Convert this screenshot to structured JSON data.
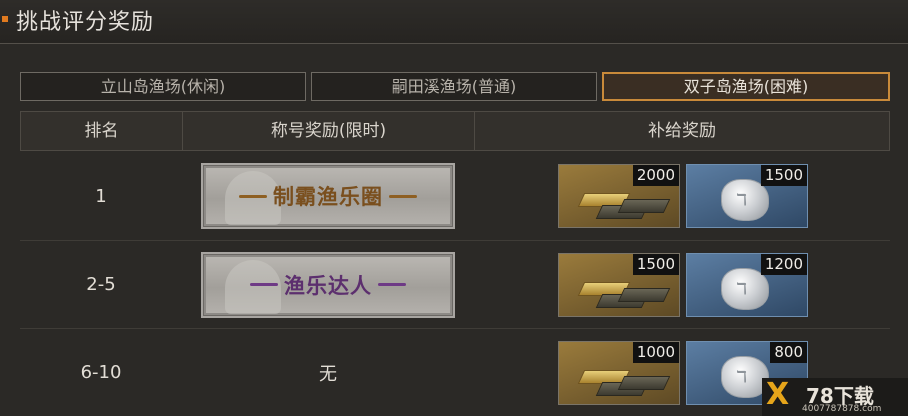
{
  "header": {
    "title": "挑战评分奖励"
  },
  "tabs": [
    {
      "label": "立山岛渔场(休闲)",
      "active": false
    },
    {
      "label": "嗣田溪渔场(普通)",
      "active": false
    },
    {
      "label": "双子岛渔场(困难)",
      "active": true
    }
  ],
  "table": {
    "columns": {
      "rank": "排名",
      "title": "称号奖励(限时)",
      "supply": "补给奖励"
    },
    "rows": [
      {
        "rank": "1",
        "title": "制霸渔乐圈",
        "title_color": "#7a4f1e",
        "gold": "2000",
        "crystal": "1500"
      },
      {
        "rank": "2-5",
        "title": "渔乐达人",
        "title_color": "#5c2f6e",
        "gold": "1500",
        "crystal": "1200"
      },
      {
        "rank": "6-10",
        "title": "无",
        "gold": "1000",
        "crystal": "800"
      }
    ]
  },
  "watermark": {
    "logo": "X",
    "name": "78下载",
    "url": "4007787878.com"
  },
  "colors": {
    "accent": "#e07a1f",
    "active_tab_border": "#c98a3a"
  }
}
